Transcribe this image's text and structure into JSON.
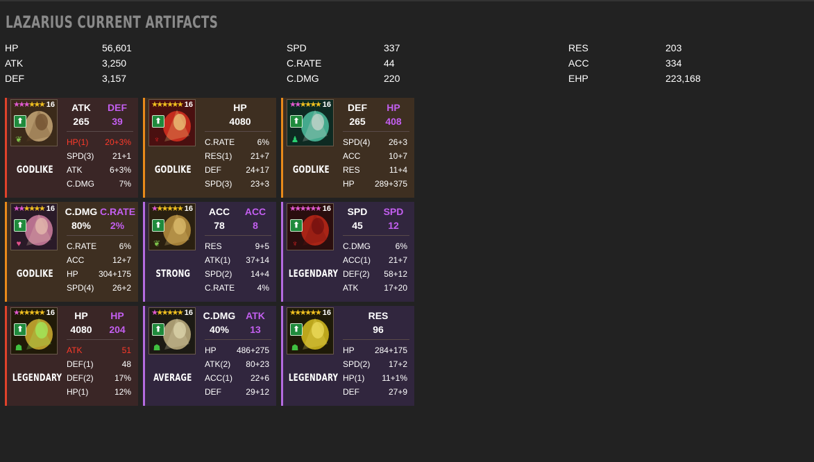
{
  "title": "Lazarius Current Artifacts",
  "stats": [
    [
      {
        "name": "HP",
        "value": "56,601"
      },
      {
        "name": "ATK",
        "value": "3,250"
      },
      {
        "name": "DEF",
        "value": "3,157"
      }
    ],
    [
      {
        "name": "SPD",
        "value": "337"
      },
      {
        "name": "C.RATE",
        "value": "44"
      },
      {
        "name": "C.DMG",
        "value": "220"
      }
    ],
    [
      {
        "name": "RES",
        "value": "203"
      },
      {
        "name": "ACC",
        "value": "334"
      },
      {
        "name": "EHP",
        "value": "223,168"
      }
    ]
  ],
  "colors": {
    "red": "#e0422b",
    "orange": "#e88a1a",
    "purple": "#b46be0",
    "secondary_main": "#c35ff0",
    "highlight": "#ff3a2a"
  },
  "artifacts": [
    {
      "slot": "weapon",
      "border": "red",
      "level": "16",
      "pink_stars": 3,
      "gold_stars": 3,
      "set_icon": "leaf-icon",
      "rarity": "GODLIKE",
      "main": [
        "ATK",
        "265"
      ],
      "secondary": [
        "DEF",
        "39"
      ],
      "subs": [
        {
          "k": "HP(1)",
          "v": "20+3%",
          "hl": true
        },
        {
          "k": "SPD(3)",
          "v": "21+1"
        },
        {
          "k": "ATK",
          "v": "6+3%"
        },
        {
          "k": "C.DMG",
          "v": "7%"
        }
      ]
    },
    {
      "slot": "helmet",
      "border": "orange",
      "level": "16",
      "pink_stars": 0,
      "gold_stars": 6,
      "set_icon": "demon-icon",
      "rarity": "GODLIKE",
      "main": [
        "HP",
        "4080"
      ],
      "secondary": null,
      "subs": [
        {
          "k": "C.RATE",
          "v": "6%"
        },
        {
          "k": "RES(1)",
          "v": "21+7"
        },
        {
          "k": "DEF",
          "v": "24+17"
        },
        {
          "k": "SPD(3)",
          "v": "23+3"
        }
      ]
    },
    {
      "slot": "shield",
      "border": "orange",
      "level": "16",
      "pink_stars": 2,
      "gold_stars": 4,
      "set_icon": "person-icon",
      "rarity": "GODLIKE",
      "main": [
        "DEF",
        "265"
      ],
      "secondary": [
        "HP",
        "408"
      ],
      "subs": [
        {
          "k": "SPD(4)",
          "v": "26+3"
        },
        {
          "k": "ACC",
          "v": "10+7"
        },
        {
          "k": "RES",
          "v": "11+4"
        },
        {
          "k": "HP",
          "v": "289+375"
        }
      ]
    },
    {
      "slot": "gloves",
      "border": "orange",
      "level": "16",
      "pink_stars": 2,
      "gold_stars": 4,
      "set_icon": "heart-icon",
      "rarity": "GODLIKE",
      "main": [
        "C.DMG",
        "80%"
      ],
      "secondary": [
        "C.RATE",
        "2%"
      ],
      "subs": [
        {
          "k": "C.RATE",
          "v": "6%"
        },
        {
          "k": "ACC",
          "v": "12+7"
        },
        {
          "k": "HP",
          "v": "304+175"
        },
        {
          "k": "SPD(4)",
          "v": "26+2"
        }
      ]
    },
    {
      "slot": "chest",
      "border": "purple",
      "level": "16",
      "pink_stars": 1,
      "gold_stars": 5,
      "set_icon": "leaf-icon",
      "rarity": "STRONG",
      "main": [
        "ACC",
        "78"
      ],
      "secondary": [
        "ACC",
        "8"
      ],
      "subs": [
        {
          "k": "RES",
          "v": "9+5"
        },
        {
          "k": "ATK(1)",
          "v": "37+14"
        },
        {
          "k": "SPD(2)",
          "v": "14+4"
        },
        {
          "k": "C.RATE",
          "v": "4%"
        }
      ]
    },
    {
      "slot": "boots",
      "border": "purple",
      "level": "16",
      "pink_stars": 6,
      "gold_stars": 0,
      "set_icon": "demon-icon",
      "rarity": "LEGENDARY",
      "main": [
        "SPD",
        "45"
      ],
      "secondary": [
        "SPD",
        "12"
      ],
      "subs": [
        {
          "k": "C.DMG",
          "v": "6%"
        },
        {
          "k": "ACC(1)",
          "v": "21+7"
        },
        {
          "k": "DEF(2)",
          "v": "58+12"
        },
        {
          "k": "ATK",
          "v": "17+20"
        }
      ]
    },
    {
      "slot": "ring",
      "border": "red",
      "level": "16",
      "pink_stars": 1,
      "gold_stars": 5,
      "set_icon": "mask-icon",
      "rarity": "LEGENDARY",
      "main": [
        "HP",
        "4080"
      ],
      "secondary": [
        "HP",
        "204"
      ],
      "subs": [
        {
          "k": "ATK",
          "v": "51",
          "hl": true
        },
        {
          "k": "DEF(1)",
          "v": "48"
        },
        {
          "k": "DEF(2)",
          "v": "17%"
        },
        {
          "k": "HP(1)",
          "v": "12%"
        }
      ]
    },
    {
      "slot": "amulet",
      "border": "purple",
      "level": "16",
      "pink_stars": 1,
      "gold_stars": 5,
      "set_icon": "mask-icon",
      "rarity": "AVERAGE",
      "main": [
        "C.DMG",
        "40%"
      ],
      "secondary": [
        "ATK",
        "13"
      ],
      "subs": [
        {
          "k": "HP",
          "v": "486+275"
        },
        {
          "k": "ATK(2)",
          "v": "80+23"
        },
        {
          "k": "ACC(1)",
          "v": "22+6"
        },
        {
          "k": "DEF",
          "v": "29+12"
        }
      ]
    },
    {
      "slot": "banner",
      "border": "purple",
      "level": "16",
      "pink_stars": 0,
      "gold_stars": 6,
      "set_icon": "mask-icon",
      "rarity": "LEGENDARY",
      "main": [
        "RES",
        "96"
      ],
      "secondary": null,
      "subs": [
        {
          "k": "HP",
          "v": "284+175"
        },
        {
          "k": "SPD(2)",
          "v": "17+2"
        },
        {
          "k": "HP(1)",
          "v": "11+1%"
        },
        {
          "k": "DEF",
          "v": "27+9"
        }
      ]
    }
  ]
}
